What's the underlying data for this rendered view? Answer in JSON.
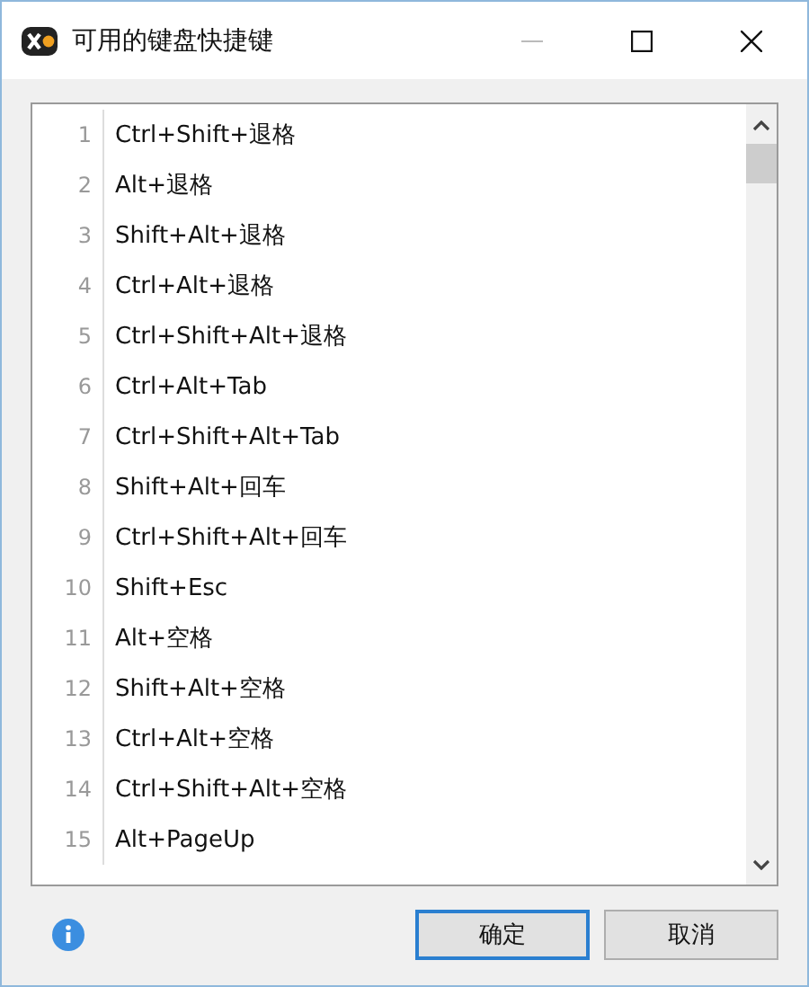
{
  "window": {
    "title": "可用的键盘快捷键"
  },
  "shortcuts": [
    {
      "number": "1",
      "keys": "Ctrl+Shift+退格"
    },
    {
      "number": "2",
      "keys": "Alt+退格"
    },
    {
      "number": "3",
      "keys": "Shift+Alt+退格"
    },
    {
      "number": "4",
      "keys": "Ctrl+Alt+退格"
    },
    {
      "number": "5",
      "keys": "Ctrl+Shift+Alt+退格"
    },
    {
      "number": "6",
      "keys": "Ctrl+Alt+Tab"
    },
    {
      "number": "7",
      "keys": "Ctrl+Shift+Alt+Tab"
    },
    {
      "number": "8",
      "keys": "Shift+Alt+回车"
    },
    {
      "number": "9",
      "keys": "Ctrl+Shift+Alt+回车"
    },
    {
      "number": "10",
      "keys": "Shift+Esc"
    },
    {
      "number": "11",
      "keys": "Alt+空格"
    },
    {
      "number": "12",
      "keys": "Shift+Alt+空格"
    },
    {
      "number": "13",
      "keys": "Ctrl+Alt+空格"
    },
    {
      "number": "14",
      "keys": "Ctrl+Shift+Alt+空格"
    },
    {
      "number": "15",
      "keys": "Alt+PageUp"
    }
  ],
  "buttons": [
    {
      "label": "确定",
      "default": true
    },
    {
      "label": "取消",
      "default": false
    }
  ]
}
